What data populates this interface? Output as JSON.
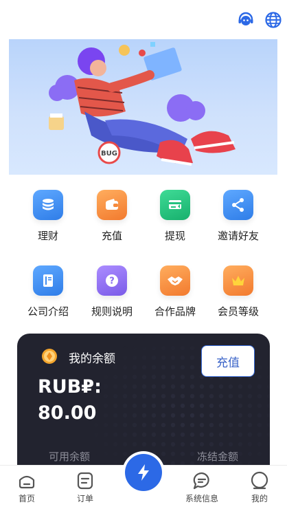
{
  "header": {
    "support_icon": "customer-service-icon",
    "language_icon": "globe-icon"
  },
  "banner": {
    "illustration": "person-with-laptop-bug",
    "badge_text": "BUG"
  },
  "menu": {
    "items": [
      {
        "label": "理财",
        "icon": "coins-stack-icon",
        "color": "#3d8bf0"
      },
      {
        "label": "充值",
        "icon": "wallet-icon",
        "color": "#f58a3c"
      },
      {
        "label": "提现",
        "icon": "card-withdraw-icon",
        "color": "#23c27f"
      },
      {
        "label": "邀请好友",
        "icon": "share-icon",
        "color": "#3d8bf0"
      },
      {
        "label": "公司介绍",
        "icon": "book-icon",
        "color": "#3d8bf0"
      },
      {
        "label": "规则说明",
        "icon": "question-icon",
        "color": "#8a6cf0"
      },
      {
        "label": "合作品牌",
        "icon": "handshake-icon",
        "color": "#f58a3c"
      },
      {
        "label": "会员等级",
        "icon": "crown-icon",
        "color": "#f58a3c"
      }
    ]
  },
  "balance": {
    "title": "我的余额",
    "recharge_label": "充值",
    "currency": "RUB₽:",
    "amount": "80.00",
    "available_label": "可用余额",
    "frozen_label": "冻结金额"
  },
  "nav": {
    "items": [
      {
        "label": "首页",
        "icon": "home-icon"
      },
      {
        "label": "订单",
        "icon": "order-icon"
      },
      {
        "label": "",
        "icon": "lightning-icon"
      },
      {
        "label": "系统信息",
        "icon": "message-icon"
      },
      {
        "label": "我的",
        "icon": "profile-icon"
      }
    ]
  },
  "colors": {
    "accent": "#2c69e6",
    "card_bg": "#22232f"
  }
}
